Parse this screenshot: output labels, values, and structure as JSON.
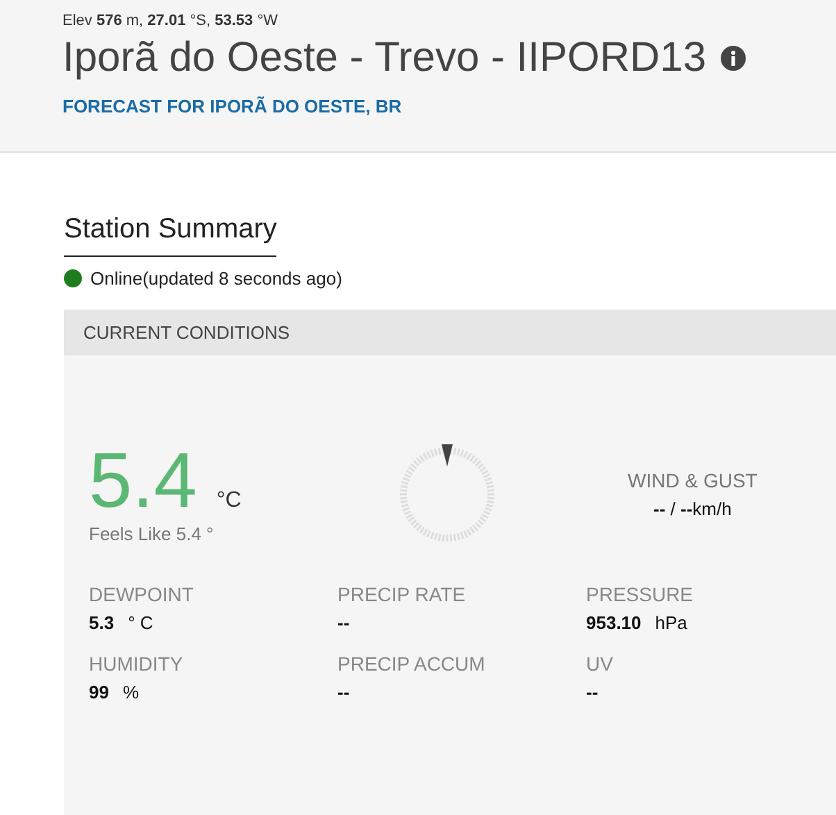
{
  "header": {
    "elevation": "Elev **576** m, **27.01** °S, **53.53** °W",
    "title": "Iporã do Oeste - Trevo - IIPORD13",
    "forecast_link": "FORECAST FOR IPORÃ DO OESTE, BR"
  },
  "summary": {
    "heading": "Station Summary",
    "online": true,
    "status": "Online(updated 8 seconds ago)"
  },
  "conditions": {
    "heading": "CURRENT CONDITIONS",
    "temperature": "5.4",
    "temperature_unit": "°C",
    "feels_like": "Feels Like 5.4 °",
    "wind_label": "WIND & GUST",
    "wind_value": "**--** / **--**km/h",
    "metrics": [
      {
        "label": "DEWPOINT",
        "value": "5.3",
        "unit": "° C"
      },
      {
        "label": "PRECIP RATE",
        "value": "--"
      },
      {
        "label": "PRESSURE",
        "value": "953.10",
        "unit": "hPa"
      },
      {
        "label": "HUMIDITY",
        "value": "99",
        "unit": "%"
      },
      {
        "label": "PRECIP ACCUM",
        "value": "--"
      },
      {
        "label": "UV",
        "value": "--"
      }
    ]
  }
}
